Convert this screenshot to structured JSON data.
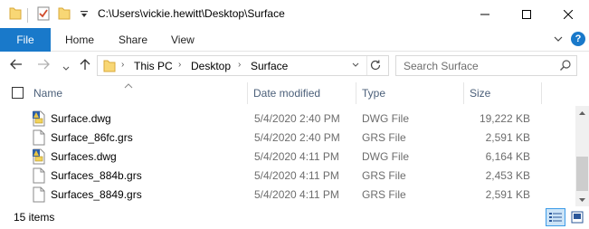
{
  "window": {
    "title": "C:\\Users\\vickie.hewitt\\Desktop\\Surface"
  },
  "quick_access": {
    "icons": [
      "folder-icon",
      "properties-icon",
      "new-folder-icon",
      "customize-dropdown-icon"
    ]
  },
  "window_controls": [
    "minimize-icon",
    "maximize-icon",
    "close-icon"
  ],
  "ribbon": {
    "file_label": "File",
    "tabs": [
      "Home",
      "Share",
      "View"
    ],
    "accent_color": "#1979ca"
  },
  "navigation": {
    "breadcrumbs": [
      "This PC",
      "Desktop",
      "Surface"
    ],
    "search_placeholder": "Search Surface"
  },
  "columns": {
    "name": "Name",
    "date_modified": "Date modified",
    "type": "Type",
    "size": "Size"
  },
  "files": [
    {
      "name": "Surface.dwg",
      "date": "5/4/2020 2:40 PM",
      "type": "DWG File",
      "size": "19,222 KB",
      "icon": "dwg-file-icon"
    },
    {
      "name": "Surface_86fc.grs",
      "date": "5/4/2020 2:40 PM",
      "type": "GRS File",
      "size": "2,591 KB",
      "icon": "generic-file-icon"
    },
    {
      "name": "Surfaces.dwg",
      "date": "5/4/2020 4:11 PM",
      "type": "DWG File",
      "size": "6,164 KB",
      "icon": "dwg-file-icon"
    },
    {
      "name": "Surfaces_884b.grs",
      "date": "5/4/2020 4:11 PM",
      "type": "GRS File",
      "size": "2,453 KB",
      "icon": "generic-file-icon"
    },
    {
      "name": "Surfaces_8849.grs",
      "date": "5/4/2020 4:11 PM",
      "type": "GRS File",
      "size": "2,591 KB",
      "icon": "generic-file-icon"
    }
  ],
  "status": {
    "item_count": "15 items"
  },
  "view_modes": {
    "active": "details"
  }
}
